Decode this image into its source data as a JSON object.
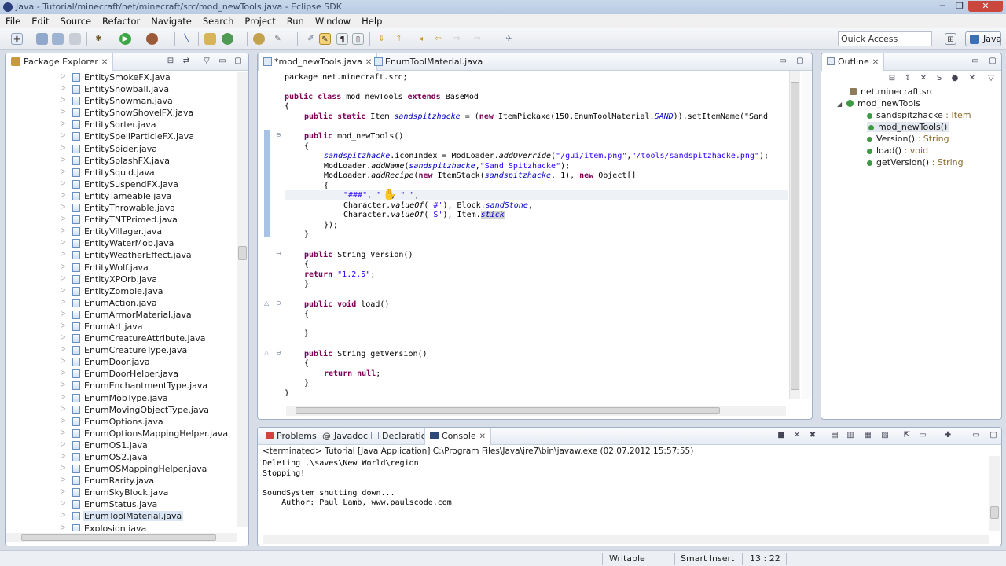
{
  "window": {
    "title": "Java - Tutorial/minecraft/net/minecraft/src/mod_newTools.java - Eclipse SDK",
    "controls": [
      "─",
      "❐",
      "✕"
    ]
  },
  "menubar": [
    "File",
    "Edit",
    "Source",
    "Refactor",
    "Navigate",
    "Search",
    "Project",
    "Run",
    "Window",
    "Help"
  ],
  "toolbar": {
    "quick_access": "Quick Access",
    "perspective": "Java"
  },
  "package_explorer": {
    "title": "Package Explorer",
    "items": [
      "EntitySmokeFX.java",
      "EntitySnowball.java",
      "EntitySnowman.java",
      "EntitySnowShovelFX.java",
      "EntitySorter.java",
      "EntitySpellParticleFX.java",
      "EntitySpider.java",
      "EntitySplashFX.java",
      "EntitySquid.java",
      "EntitySuspendFX.java",
      "EntityTameable.java",
      "EntityThrowable.java",
      "EntityTNTPrimed.java",
      "EntityVillager.java",
      "EntityWaterMob.java",
      "EntityWeatherEffect.java",
      "EntityWolf.java",
      "EntityXPOrb.java",
      "EntityZombie.java",
      "EnumAction.java",
      "EnumArmorMaterial.java",
      "EnumArt.java",
      "EnumCreatureAttribute.java",
      "EnumCreatureType.java",
      "EnumDoor.java",
      "EnumDoorHelper.java",
      "EnumEnchantmentType.java",
      "EnumMobType.java",
      "EnumMovingObjectType.java",
      "EnumOptions.java",
      "EnumOptionsMappingHelper.java",
      "EnumOS1.java",
      "EnumOS2.java",
      "EnumOSMappingHelper.java",
      "EnumRarity.java",
      "EnumSkyBlock.java",
      "EnumStatus.java",
      "EnumToolMaterial.java",
      "Explosion.java"
    ],
    "selected": "EnumToolMaterial.java"
  },
  "editor": {
    "tabs": [
      {
        "label": "*mod_newTools.java"
      },
      {
        "label": "EnumToolMaterial.java"
      }
    ],
    "code": {
      "l1": "package net.minecraft.src;",
      "l2_kw": "public class",
      "l2_a": " mod_newTools ",
      "l2_kw2": "extends",
      "l2_b": " BaseMod",
      "l3": "{",
      "l4_kw": "public static",
      "l4_a": " Item ",
      "l4_f": "sandspitzhacke",
      "l4_b": " = (",
      "l4_kw2": "new",
      "l4_c": " ItemPickaxe(150,EnumToolMaterial.",
      "l4_f2": "SAND",
      "l4_d": ")).setItemName(\"Sand",
      "l5_kw": "public",
      "l5_a": " mod_newTools()",
      "l6": "{",
      "l7_f": "sandspitzhacke",
      "l7_a": ".iconIndex = ModLoader.",
      "l7_i": "addOverride",
      "l7_s1": "\"/gui/item.png\"",
      "l7_s2": "\"/tools/sandspitzhacke.png\"",
      "l7_b": ");",
      "l8_a": "ModLoader.",
      "l8_i": "addName",
      "l8_f": "sandspitzhacke",
      "l8_s": "\"Sand Spitzhacke\"",
      "l8_b": ");",
      "l9_a": "ModLoader.",
      "l9_i": "addRecipe",
      "l9_kw": "new",
      "l9_b": " ItemStack(",
      "l9_f": "sandspitzhacke",
      "l9_c": ", 1), ",
      "l9_kw2": "new",
      "l9_d": " Object[]",
      "l10": "{",
      "l11_s1": "\"###\"",
      "l11_s2": "\" \"",
      "l11_s3": "\" \"",
      "l12_a": "Character.",
      "l12_i": "valueOf",
      "l12_s": "'#'",
      "l12_b": "), Block.",
      "l12_f": "sandStone",
      "l13_a": "Character.",
      "l13_i": "valueOf",
      "l13_s": "'S'",
      "l13_b": "), Item.",
      "l13_f": "stick",
      "l14": "});",
      "l15": "}",
      "l16_kw": "public",
      "l16_a": " String Version()",
      "l17": "{",
      "l18_kw": "return",
      "l18_s": "\"1.2.5\"",
      "l18_b": ";",
      "l19": "}",
      "l20_kw": "public void",
      "l20_a": " load()",
      "l21": "{",
      "l22": "}",
      "l23_kw": "public",
      "l23_a": " String getVersion()",
      "l24": "{",
      "l25_kw": "return null",
      "l25_b": ";",
      "l26": "}",
      "l27": "}"
    }
  },
  "outline": {
    "title": "Outline",
    "items": [
      {
        "label": "net.minecraft.src",
        "detail": ""
      },
      {
        "label": "mod_newTools",
        "detail": ""
      },
      {
        "label": "sandspitzhacke",
        "detail": " : Item"
      },
      {
        "label": "mod_newTools()",
        "detail": ""
      },
      {
        "label": "Version()",
        "detail": " : String"
      },
      {
        "label": "load()",
        "detail": " : void"
      },
      {
        "label": "getVersion()",
        "detail": " : String"
      }
    ]
  },
  "bottom": {
    "tabs": [
      "Problems",
      "Javadoc",
      "Declaration",
      "Console"
    ],
    "console_header": "<terminated> Tutorial [Java Application] C:\\Program Files\\Java\\jre7\\bin\\javaw.exe (02.07.2012 15:57:55)",
    "console_lines": [
      "Deleting .\\saves\\New World\\region",
      "Stopping!",
      "",
      "SoundSystem shutting down...",
      "    Author: Paul Lamb, www.paulscode.com"
    ]
  },
  "status": {
    "writable": "Writable",
    "insert_mode": "Smart Insert",
    "position": "13 : 22"
  },
  "colors": {
    "keyword": "#7f0055",
    "string": "#2a00ff",
    "field": "#0000c0",
    "panel_border": "#9fb0c8"
  }
}
